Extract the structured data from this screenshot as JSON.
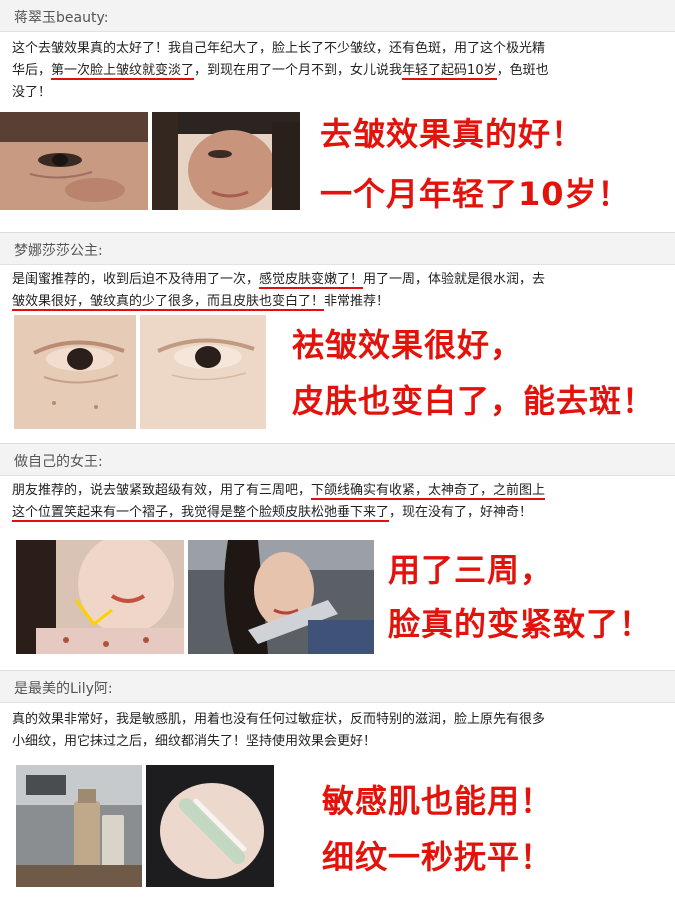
{
  "reviews": [
    {
      "author": "蒋翠玉beauty:",
      "text_a": "这个去皱效果真的太好了！我自己年纪大了，脸上长了不少皱纹，还有色斑，用了这个极光精",
      "text_b1": "华后，",
      "text_b_ul": "第一次脸上皱纹就变淡了",
      "text_b2": "，到现在用了一个月不到，女儿说我",
      "text_b_ul2": "年轻了起码10岁",
      "text_b3": "，色斑也",
      "text_c": "没了！",
      "slogan_1": "去皱效果真的好！",
      "slogan_2": "一个月年轻了10岁！"
    },
    {
      "author": "梦娜莎莎公主:",
      "text_a1": "是闺蜜推荐的，收到后迫不及待用了一次，",
      "text_a_ul": "感觉皮肤变嫩了！",
      "text_a2": "用了一周，体验就是很水润，去",
      "text_b_ul": "皱效果很好，皱纹真的少了很多，而且皮肤也变白了！",
      "text_b2": "非常推荐！",
      "slogan_1": "祛皱效果很好，",
      "slogan_2": "皮肤也变白了，能去斑！"
    },
    {
      "author": "做自己的女王:",
      "text_a1": "朋友推荐的，说去皱紧致超级有效，用了有三周吧，",
      "text_a_ul": "下颌线确实有收紧，太神奇了，之前图上",
      "text_b_ul": "这个位置笑起来有一个褶子，我觉得是整个脸颊皮肤松弛垂下来了",
      "text_b2": "，现在没有了，好神奇！",
      "slogan_1": "用了三周，",
      "slogan_2": "脸真的变紧致了！"
    },
    {
      "author": "是最美的Lily阿:",
      "text_a": "真的效果非常好，我是敏感肌，用着也没有任何过敏症状，反而特别的滋润，脸上原先有很多",
      "text_b": "小细纹，用它抹过之后，细纹都消失了！坚持使用效果会更好！",
      "slogan_1": "敏感肌也能用！",
      "slogan_2": "细纹一秒抚平！"
    }
  ],
  "colors": {
    "accent_red": "#e3120b",
    "header_bg": "#f3f3f3"
  },
  "photos": [
    "face-closeup-before-photo",
    "face-closeup-after-photo",
    "eye-area-before-photo",
    "eye-area-after-photo",
    "jawline-before-photo",
    "jawline-after-photo",
    "product-bottle-photo",
    "hand-swatch-photo"
  ]
}
